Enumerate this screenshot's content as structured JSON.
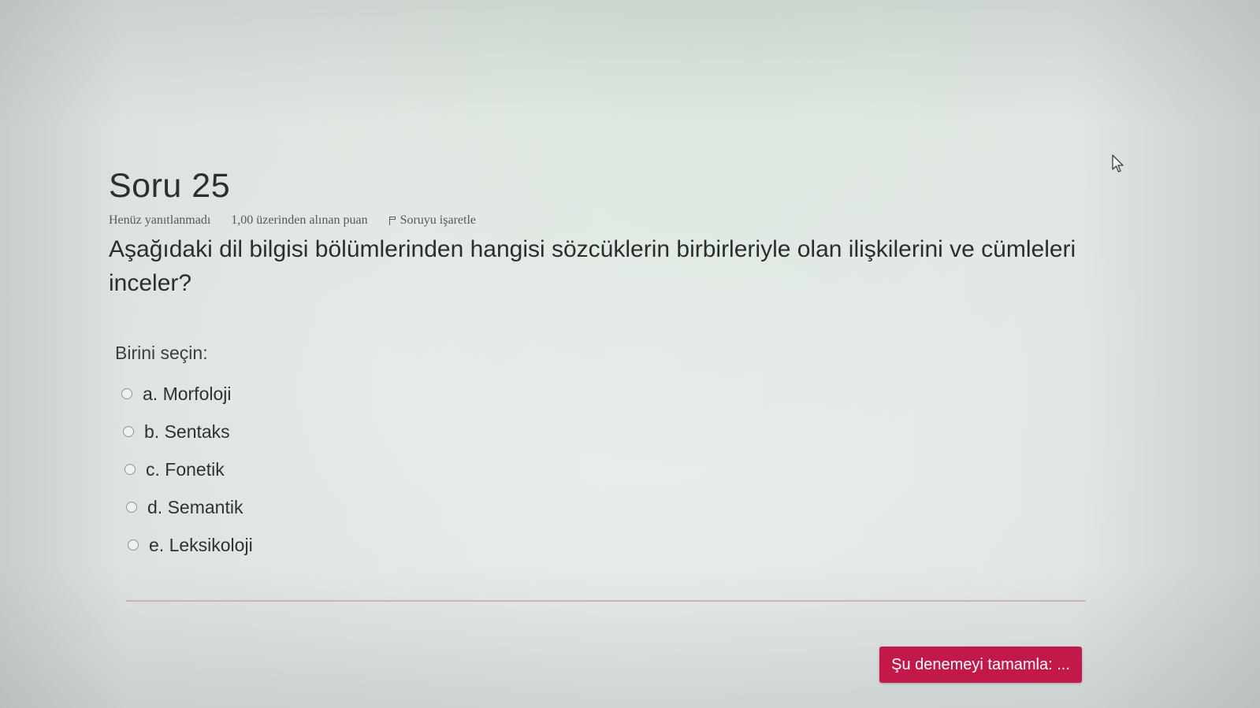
{
  "question": {
    "title": "Soru 25",
    "status": "Henüz yanıtlanmadı",
    "grade": "1,00 üzerinden alınan puan",
    "flag_label": "Soruyu işaretle",
    "text": "Aşağıdaki dil bilgisi bölümlerinden hangisi sözcüklerin birbirleriyle olan ilişkilerini ve cümleleri inceler?",
    "prompt": "Birini seçin:",
    "options": [
      {
        "label": "a. Morfoloji"
      },
      {
        "label": "b. Sentaks"
      },
      {
        "label": "c. Fonetik"
      },
      {
        "label": "d. Semantik"
      },
      {
        "label": "e. Leksikoloji"
      }
    ]
  },
  "footer": {
    "finish_button": "Şu denemeyi tamamla: ..."
  },
  "colors": {
    "accent": "#c3184a",
    "divider": "#cdb3bd"
  },
  "icons": {
    "flag": "flag-icon",
    "cursor": "mouse-pointer-icon"
  }
}
